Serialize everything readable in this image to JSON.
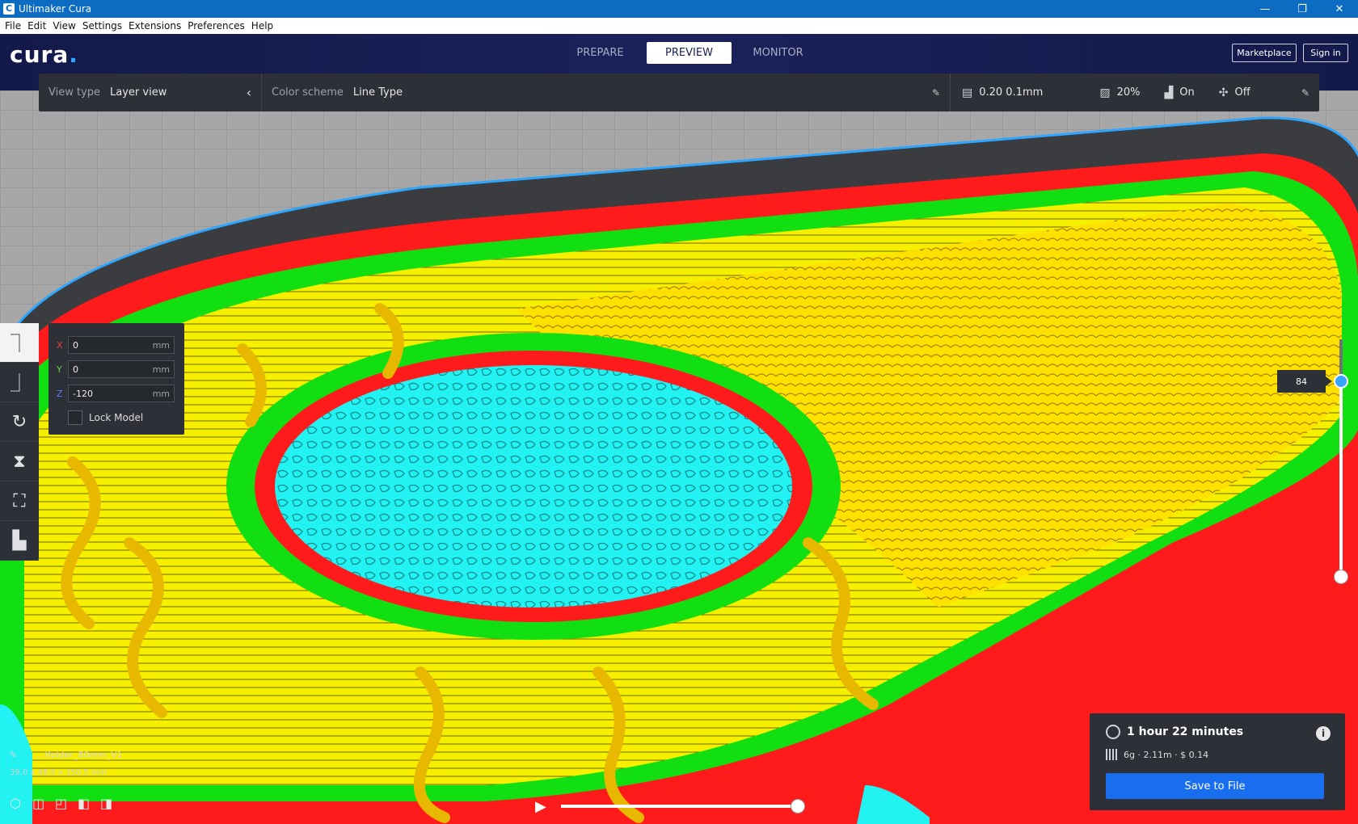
{
  "window": {
    "title": "Ultimaker Cura",
    "minimize": "—",
    "restore": "❐",
    "close": "✕"
  },
  "menu": [
    "File",
    "Edit",
    "View",
    "Settings",
    "Extensions",
    "Preferences",
    "Help"
  ],
  "header": {
    "logo": "cura",
    "tabs": [
      {
        "label": "PREPARE",
        "active": false
      },
      {
        "label": "PREVIEW",
        "active": true
      },
      {
        "label": "MONITOR",
        "active": false
      }
    ],
    "marketplace": "Marketplace",
    "signin": "Sign in"
  },
  "settings_bar": {
    "view_type_label": "View type",
    "view_type_value": "Layer view",
    "color_scheme_label": "Color scheme",
    "color_scheme_value": "Line Type",
    "profile": "0.20 0.1mm",
    "infill": "20%",
    "support": "On",
    "adhesion": "Off"
  },
  "transform_panel": {
    "x_label": "X",
    "x_value": "0",
    "x_unit": "mm",
    "y_label": "Y",
    "y_value": "0",
    "y_unit": "mm",
    "z_label": "Z",
    "z_value": "-120",
    "z_unit": "mm",
    "lock_label": "Lock Model"
  },
  "tools": [
    "move-tool-icon",
    "scale-tool-icon",
    "rotate-tool-icon",
    "mirror-tool-icon",
    "per-model-settings-icon",
    "support-blocker-icon"
  ],
  "layer_slider": {
    "current_layer": "84"
  },
  "object": {
    "name": "...lfolder_80mm_V1",
    "dims": "39.0 x 48.0 x 150.5 mm"
  },
  "summary": {
    "time": "1 hour 22 minutes",
    "stats": "6g · 2.11m · $ 0.14",
    "save": "Save to File"
  },
  "colors": {
    "header": "#171c4d",
    "accent": "#196ef0",
    "shell": "#ff1b1b",
    "inner_wall": "#10e010",
    "infill": "#ffe000",
    "top_bottom": "#1ef0f0"
  }
}
